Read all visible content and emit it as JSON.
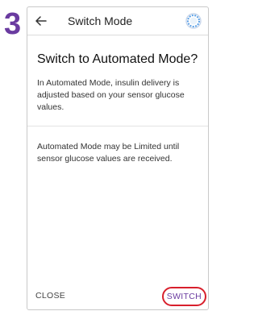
{
  "step_number": "3",
  "header": {
    "title": "Switch Mode"
  },
  "dialog": {
    "title": "Switch to Automated Mode?",
    "body": "In Automated Mode, insulin delivery is adjusted based on your sensor glucose values.",
    "note": "Automated Mode may be Limited until sensor glucose values are received."
  },
  "footer": {
    "close_label": "CLOSE",
    "switch_label": "SWITCH"
  },
  "colors": {
    "accent": "#6a3ba0",
    "highlight_ring": "#d81f2c"
  },
  "icons": {
    "back": "back-arrow-icon",
    "status": "progress-ring-icon"
  }
}
